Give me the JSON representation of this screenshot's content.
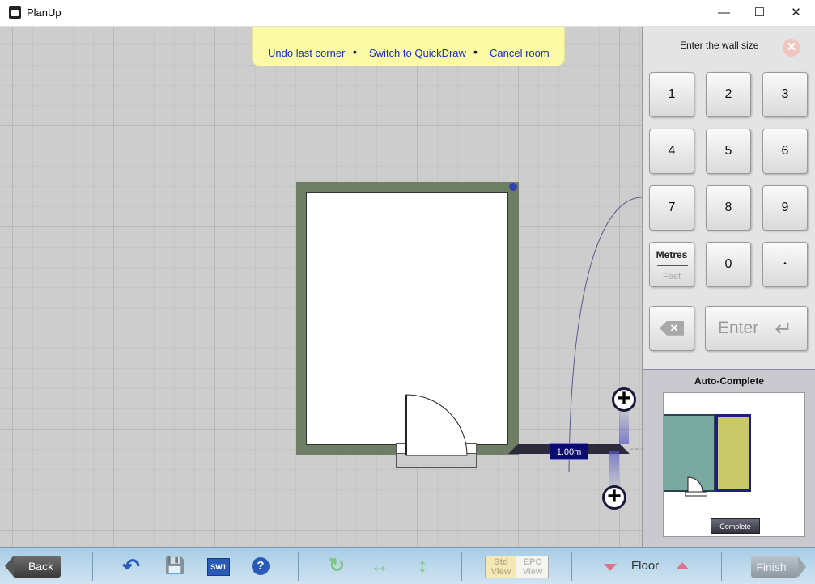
{
  "window": {
    "title": "PlanUp",
    "minimize": "—",
    "maximize": "☐",
    "close": "✕"
  },
  "hint_bar": {
    "undo_label": "Undo last corner",
    "switch_label": "Switch to QuickDraw",
    "cancel_label": "Cancel room",
    "separator": "•"
  },
  "canvas": {
    "dimension_label": "1.00m",
    "plus_top": "+",
    "plus_bottom": "+"
  },
  "keypad": {
    "prompt": "Enter the wall size",
    "close_glyph": "✕",
    "keys": [
      "1",
      "2",
      "3",
      "4",
      "5",
      "6",
      "7",
      "8",
      "9"
    ],
    "zero": "0",
    "decimal": "•",
    "units_primary": "Metres",
    "units_secondary": "Feet",
    "backspace_glyph": "✕",
    "enter_label": "Enter",
    "enter_glyph": "↵"
  },
  "auto_complete": {
    "title": "Auto-Complete",
    "complete_label": "Complete"
  },
  "toolbar": {
    "back_label": "Back",
    "undo_glyph": "↶",
    "save_glyph": "💾",
    "sw1_label": "SW1",
    "help_glyph": "?",
    "rotate_glyph": "↻",
    "flip_h_glyph": "↔",
    "flip_v_glyph": "↕",
    "std_view_label": "Std View",
    "epc_view_label": "EPC View",
    "floor_label": "Floor",
    "finish_label": "Finish"
  },
  "colors": {
    "wall": "#6e7e64",
    "hint_bg": "#fbfba5",
    "link_blue": "#1b2bd4",
    "toolbar_bg": "#b9d8ec",
    "accent_pink": "#e0708a"
  }
}
